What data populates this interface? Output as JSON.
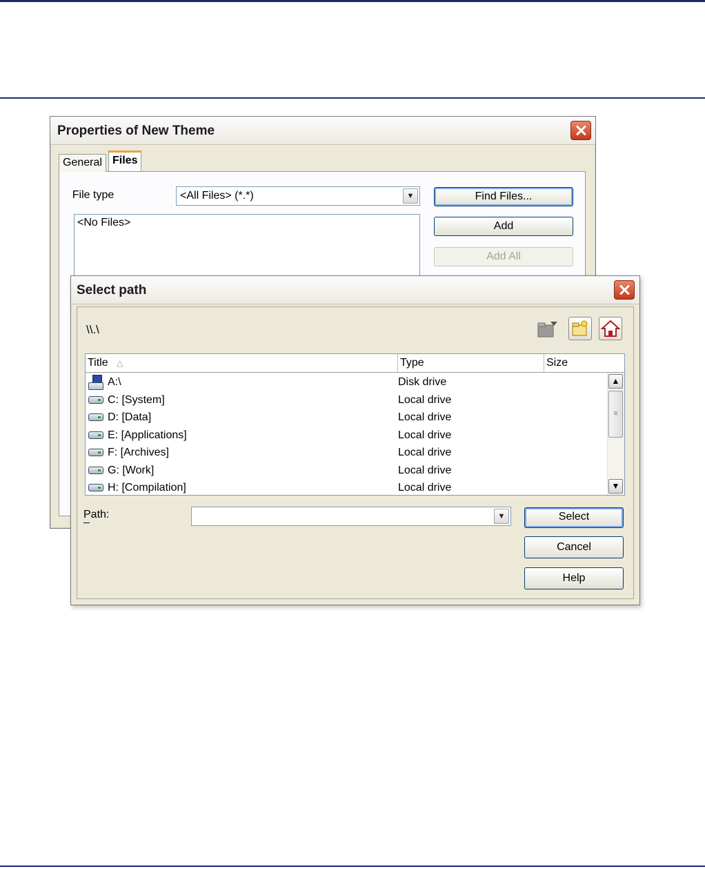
{
  "properties_dialog": {
    "title": "Properties of New Theme",
    "tabs": [
      {
        "label": "General"
      },
      {
        "label": "Files"
      }
    ],
    "file_type_label": "File type",
    "file_type_value": "<All Files> (*.*)",
    "file_list_placeholder": "<No Files>",
    "buttons": {
      "find_files": "Find Files...",
      "add": "Add",
      "add_all": "Add All"
    }
  },
  "select_path_dialog": {
    "title": "Select path",
    "current_location": "\\\\.\\",
    "toolbar_icons": [
      "folder-up-icon",
      "new-folder-icon",
      "home-icon"
    ],
    "columns": {
      "title": "Title",
      "type": "Type",
      "size": "Size"
    },
    "rows": [
      {
        "icon": "floppy-drive-icon",
        "title": "A:\\",
        "type": "Disk drive"
      },
      {
        "icon": "local-drive-icon",
        "title": "C: [System]",
        "type": "Local drive"
      },
      {
        "icon": "local-drive-icon",
        "title": "D: [Data]",
        "type": "Local drive"
      },
      {
        "icon": "local-drive-icon",
        "title": "E: [Applications]",
        "type": "Local drive"
      },
      {
        "icon": "local-drive-icon",
        "title": "F: [Archives]",
        "type": "Local drive"
      },
      {
        "icon": "local-drive-icon",
        "title": "G: [Work]",
        "type": "Local drive"
      },
      {
        "icon": "local-drive-icon",
        "title": "H: [Compilation]",
        "type": "Local drive"
      }
    ],
    "path_label": "Path:",
    "path_value": "",
    "buttons": {
      "select": "Select",
      "cancel": "Cancel",
      "help": "Help"
    }
  }
}
